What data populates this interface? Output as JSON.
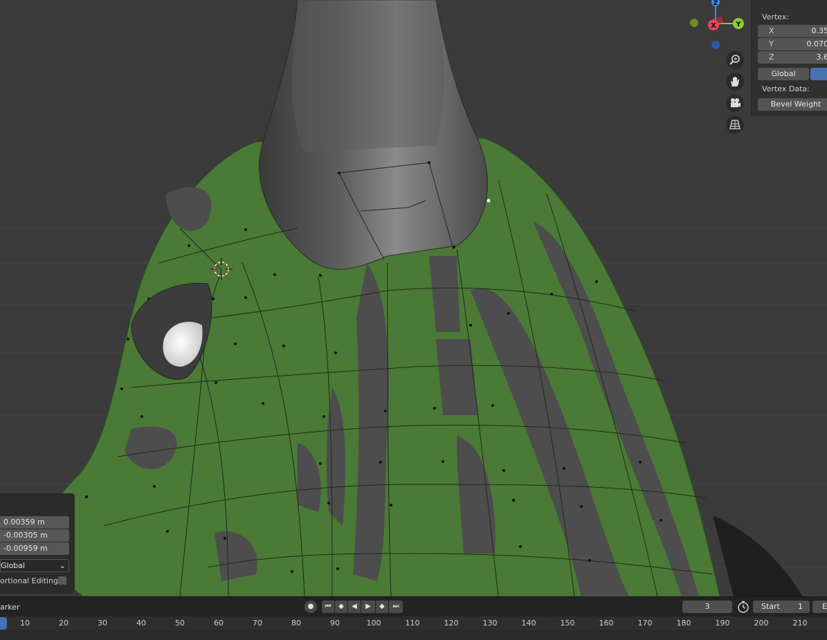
{
  "sidebar": {
    "vertex_label": "Vertex:",
    "x_key": "X",
    "x_value": "0.35",
    "y_key": "Y",
    "y_value": "0.070",
    "z_key": "Z",
    "z_value": "3.6",
    "global_label": "Global",
    "vertex_data_label": "Vertex Data:",
    "bevel_weight_label": "Bevel Weight"
  },
  "gizmo": {
    "z_label": "Z",
    "x_label": "X",
    "y_label": "Y"
  },
  "nav_icons": [
    "zoom-icon",
    "hand-pan-icon",
    "camera-icon",
    "grid-perspective-icon"
  ],
  "redo_panel": {
    "values": [
      "0.00359 m",
      "-0.00305 m",
      "-0.00959 m"
    ],
    "orientation": "Global",
    "proportional_label": "ortional Editing"
  },
  "timeline": {
    "marker_label": "arker",
    "current_frame": "3",
    "start_label": "Start",
    "start_value": "1",
    "end_label": "E",
    "ruler_ticks": [
      "10",
      "20",
      "30",
      "40",
      "50",
      "60",
      "70",
      "80",
      "90",
      "100",
      "110",
      "120",
      "130",
      "140",
      "150",
      "160",
      "170",
      "180",
      "190",
      "200",
      "210"
    ]
  },
  "colors": {
    "accent": "#4772b3",
    "mesh_green": "#4a7a36",
    "axis_x": "#e8455a",
    "axis_y": "#8ccc2f",
    "axis_z": "#3b8cf0"
  }
}
